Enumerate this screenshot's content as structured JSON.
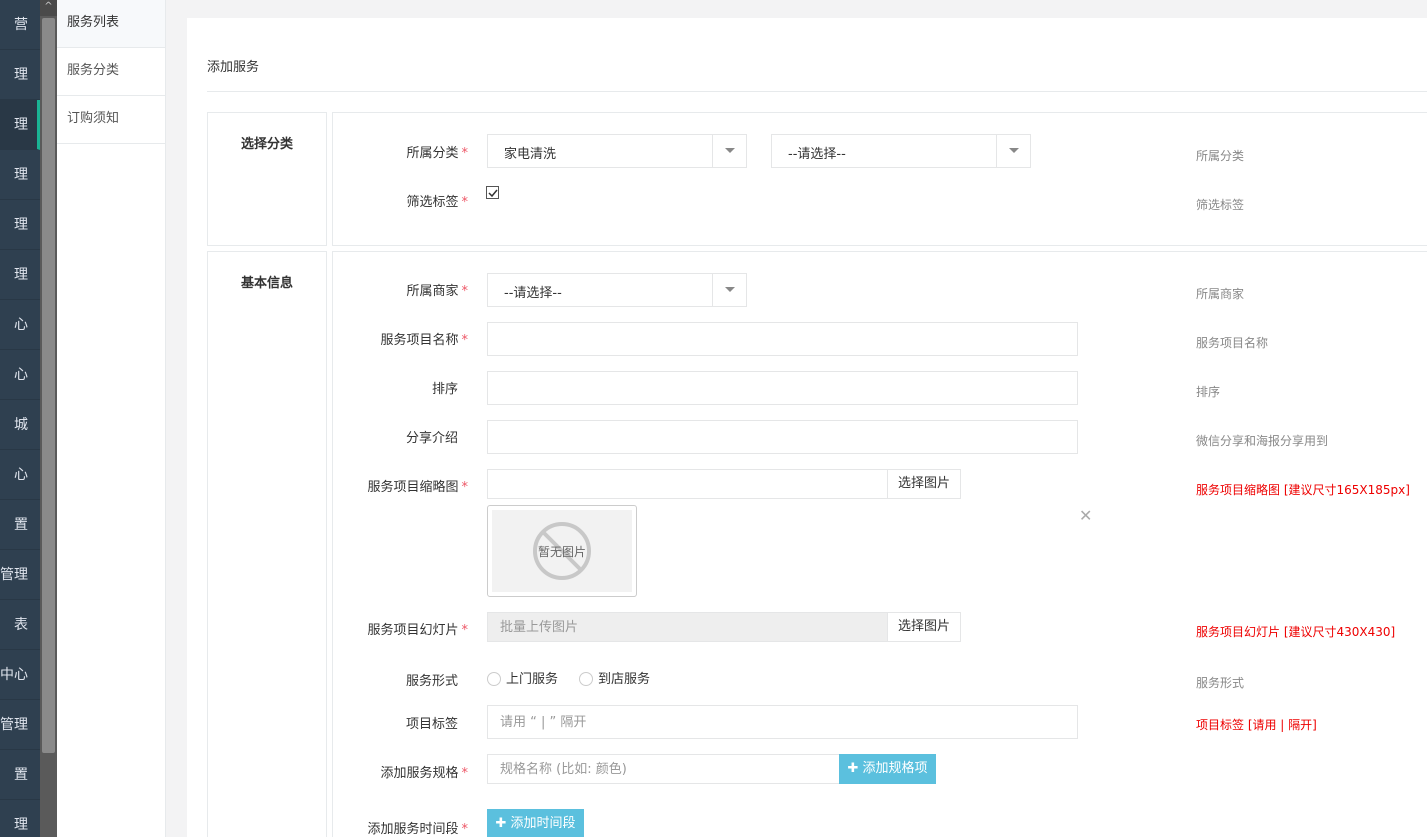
{
  "leftnav": {
    "items": [
      "营",
      "理",
      "理",
      "理",
      "理",
      "理",
      "心",
      "心",
      "城",
      "心",
      "置",
      "管理",
      "表",
      "中心",
      "管理",
      "置",
      "理"
    ],
    "active_index": 2,
    "scroll_up": "^"
  },
  "submenu": {
    "items": [
      "服务列表",
      "服务分类",
      "订购须知"
    ]
  },
  "page": {
    "title": "添加服务"
  },
  "section_category": {
    "title": "选择分类",
    "category_label": "所属分类",
    "category_value": "家电清洗",
    "subcategory_value": "--请选择--",
    "filter_label": "筛选标签",
    "help_category": "所属分类",
    "help_filter": "筛选标签"
  },
  "section_basic": {
    "title": "基本信息",
    "merchant_label": "所属商家",
    "merchant_value": "--请选择--",
    "help_merchant": "所属商家",
    "name_label": "服务项目名称",
    "help_name": "服务项目名称",
    "sort_label": "排序",
    "help_sort": "排序",
    "share_label": "分享介绍",
    "help_share": "微信分享和海报分享用到",
    "thumb_label": "服务项目缩略图",
    "choose_image": "选择图片",
    "no_image": "暂无图片",
    "help_thumb": "服务项目缩略图 [建议尺寸165X185px]",
    "slide_label": "服务项目幻灯片",
    "slide_placeholder": "批量上传图片",
    "help_slide": "服务项目幻灯片 [建议尺寸430X430]",
    "form_label": "服务形式",
    "form_options": [
      "上门服务",
      "到店服务"
    ],
    "help_form": "服务形式",
    "tag_label": "项目标签",
    "tag_placeholder": "请用 “ | ” 隔开",
    "help_tag": "项目标签 [请用 | 隔开]",
    "spec_label": "添加服务规格",
    "spec_placeholder": "规格名称 (比如: 颜色)",
    "spec_button": "✚ 添加规格项",
    "time_label": "添加服务时间段",
    "time_button": "✚ 添加时间段"
  },
  "colors": {
    "required": "#ed5565",
    "help_red": "#ee0000",
    "info_button": "#5bc0de",
    "nav_bg": "#2f4050"
  }
}
